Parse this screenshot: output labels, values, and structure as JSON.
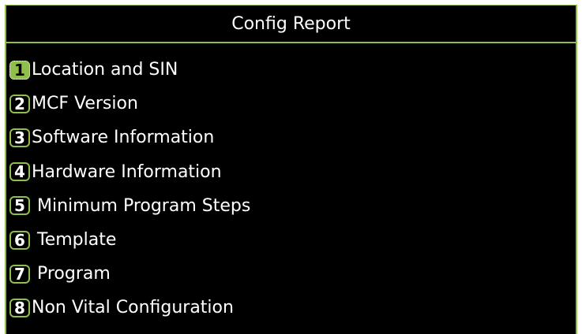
{
  "header": {
    "title": "Config Report"
  },
  "colors": {
    "background": "#000000",
    "accent": "#8fbf4a",
    "text": "#ffffff"
  },
  "menu": {
    "items": [
      {
        "key": "1",
        "label": "Location and SIN",
        "selected": true
      },
      {
        "key": "2",
        "label": "MCF Version",
        "selected": false
      },
      {
        "key": "3",
        "label": "Software Information",
        "selected": false
      },
      {
        "key": "4",
        "label": "Hardware Information",
        "selected": false
      },
      {
        "key": "5",
        "label": " Minimum Program Steps",
        "selected": false
      },
      {
        "key": "6",
        "label": " Template",
        "selected": false
      },
      {
        "key": "7",
        "label": " Program",
        "selected": false
      },
      {
        "key": "8",
        "label": "Non Vital Configuration",
        "selected": false
      }
    ]
  }
}
